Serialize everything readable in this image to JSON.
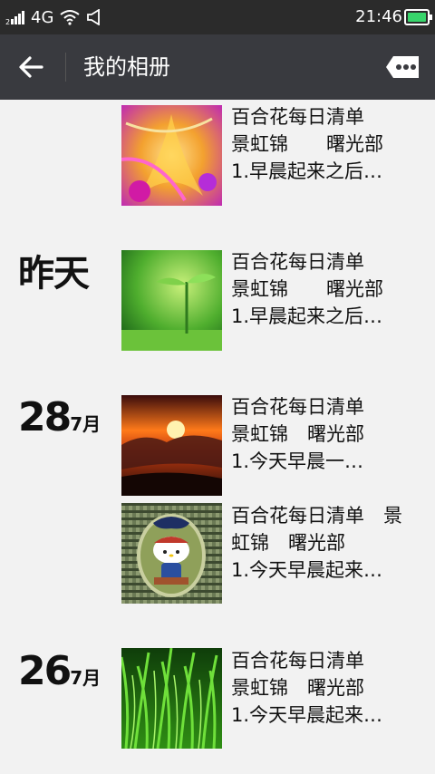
{
  "status_bar": {
    "signal_label": "4G",
    "time": "21:46",
    "icons": [
      "signal-icon",
      "wifi-icon",
      "sound-icon",
      "battery-icon"
    ]
  },
  "title_bar": {
    "title": "我的相册",
    "back_icon": "arrow-left-icon",
    "more_icon": "more-icon"
  },
  "groups": [
    {
      "date_label": "",
      "entries": [
        {
          "thumb": "purple-flower",
          "line1": "百合花每日清单",
          "line2": "景虹锦　　曙光部",
          "line3": "1.早晨起来之后…"
        }
      ]
    },
    {
      "date_label": "昨天",
      "entries": [
        {
          "thumb": "green-sprout",
          "line1": "百合花每日清单",
          "line2": "景虹锦　　曙光部",
          "line3": "1.早晨起来之后…"
        }
      ]
    },
    {
      "day": "28",
      "month": "7月",
      "entries": [
        {
          "thumb": "sunset-clouds",
          "line1": "百合花每日清单",
          "line2": "景虹锦　曙光部",
          "line3": "1.今天早晨一…"
        },
        {
          "thumb": "hello-kitty",
          "line1": "百合花每日清单　景",
          "line2": "虹锦　曙光部",
          "line3": "1.今天早晨起来…"
        }
      ]
    },
    {
      "day": "26",
      "month": "7月",
      "entries": [
        {
          "thumb": "green-grass",
          "line1": "百合花每日清单",
          "line2": "景虹锦　曙光部",
          "line3": "1.今天早晨起来…"
        }
      ]
    }
  ]
}
